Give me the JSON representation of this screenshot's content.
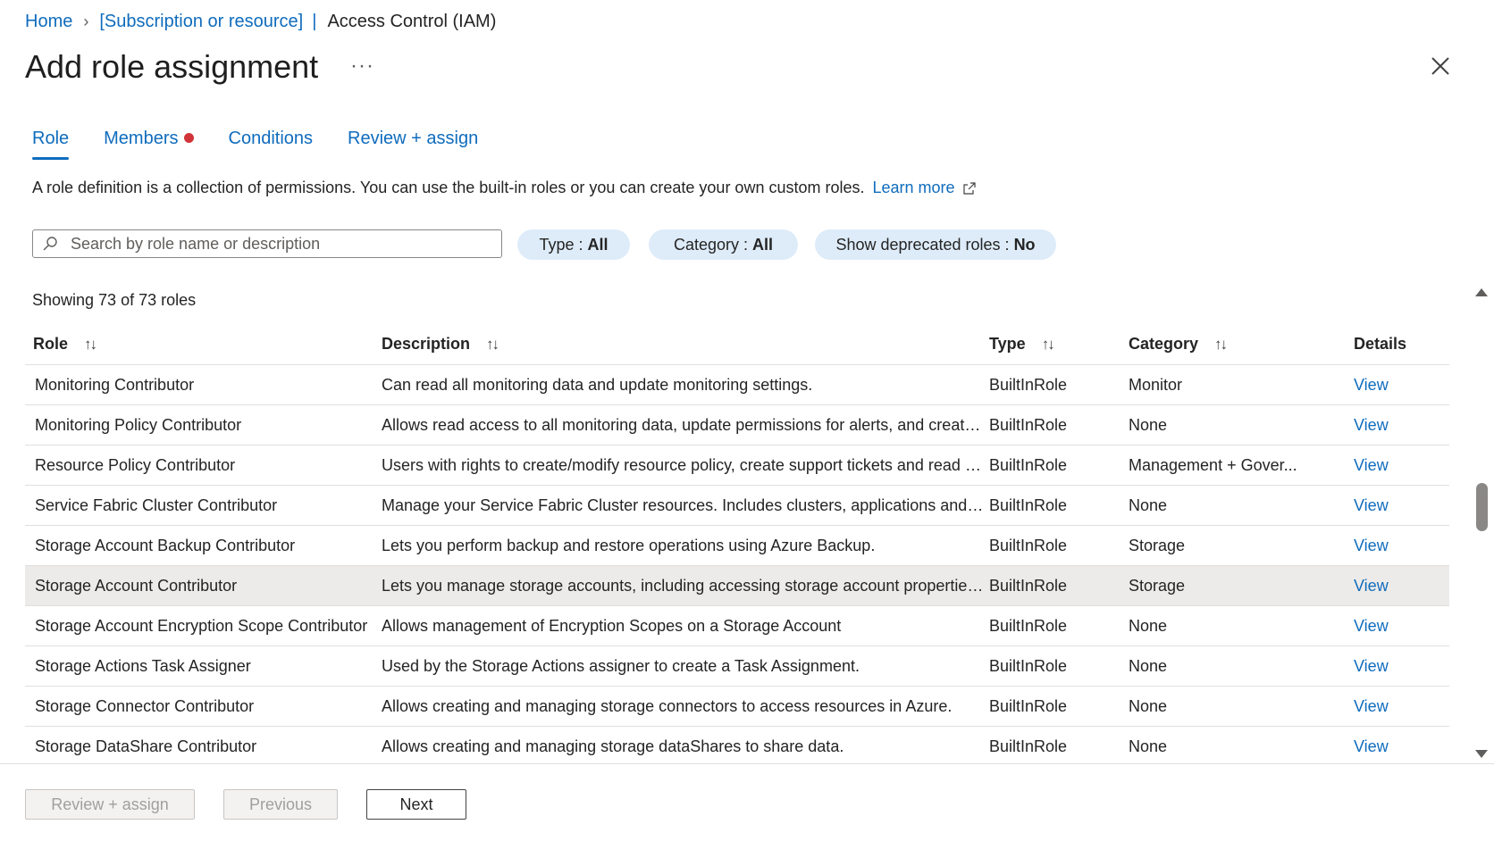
{
  "breadcrumb": {
    "home": "Home",
    "resource": "[Subscription or resource]",
    "divider": "|",
    "current": "Access Control (IAM)"
  },
  "page": {
    "title": "Add role assignment",
    "more": "···"
  },
  "tabs": [
    {
      "label": "Role",
      "active": true
    },
    {
      "label": "Members",
      "dot": true
    },
    {
      "label": "Conditions"
    },
    {
      "label": "Review + assign"
    }
  ],
  "intro": {
    "text": "A role definition is a collection of permissions. You can use the built-in roles or you can create your own custom roles.",
    "learn_more": "Learn more"
  },
  "search": {
    "placeholder": "Search by role name or description",
    "value": ""
  },
  "filters": {
    "type": {
      "label": "Type :",
      "value": "All"
    },
    "category": {
      "label": "Category :",
      "value": "All"
    },
    "deprecated": {
      "label": "Show deprecated roles :",
      "value": "No"
    }
  },
  "table": {
    "count_text": "Showing 73 of 73 roles",
    "headers": {
      "role": "Role",
      "description": "Description",
      "type": "Type",
      "category": "Category",
      "details": "Details"
    },
    "sort_glyph": "↑↓",
    "rows": [
      {
        "role": "Monitoring Contributor",
        "description": "Can read all monitoring data and update monitoring settings.",
        "type": "BuiltInRole",
        "category": "Monitor",
        "details": "View"
      },
      {
        "role": "Monitoring Policy Contributor",
        "description": "Allows read access to all monitoring data, update permissions for alerts, and create actio...",
        "type": "BuiltInRole",
        "category": "None",
        "details": "View"
      },
      {
        "role": "Resource Policy Contributor",
        "description": "Users with rights to create/modify resource policy, create support tickets and read al...",
        "type": "BuiltInRole",
        "category": "Management + Gover...",
        "details": "View"
      },
      {
        "role": "Service Fabric Cluster Contributor",
        "description": "Manage your Service Fabric Cluster resources. Includes clusters, applications and servic...",
        "type": "BuiltInRole",
        "category": "None",
        "details": "View"
      },
      {
        "role": "Storage Account Backup Contributor",
        "description": "Lets you perform backup and restore operations using Azure Backup.",
        "type": "BuiltInRole",
        "category": "Storage",
        "details": "View"
      },
      {
        "role": "Storage Account Contributor",
        "description": "Lets you manage storage accounts, including accessing storage account properties and ...",
        "type": "BuiltInRole",
        "category": "Storage",
        "details": "View",
        "selected": true
      },
      {
        "role": "Storage Account Encryption Scope Contributor",
        "description": "Allows management of Encryption Scopes on a Storage Account",
        "type": "BuiltInRole",
        "category": "None",
        "details": "View"
      },
      {
        "role": "Storage Actions Task Assigner",
        "description": "Used by the Storage Actions assigner to create a Task Assignment.",
        "type": "BuiltInRole",
        "category": "None",
        "details": "View"
      },
      {
        "role": "Storage Connector Contributor",
        "description": "Allows creating and managing storage connectors to access resources in Azure.",
        "type": "BuiltInRole",
        "category": "None",
        "details": "View"
      },
      {
        "role": "Storage DataShare Contributor",
        "description": "Allows creating and managing storage dataShares to share data.",
        "type": "BuiltInRole",
        "category": "None",
        "details": "View"
      }
    ]
  },
  "footer": {
    "review_assign": "Review + assign",
    "previous": "Previous",
    "next": "Next"
  },
  "colors": {
    "accent": "#0f6cbd",
    "dot": "#d13438",
    "pill_bg": "#deecf9",
    "selected_row": "#edebe9"
  }
}
